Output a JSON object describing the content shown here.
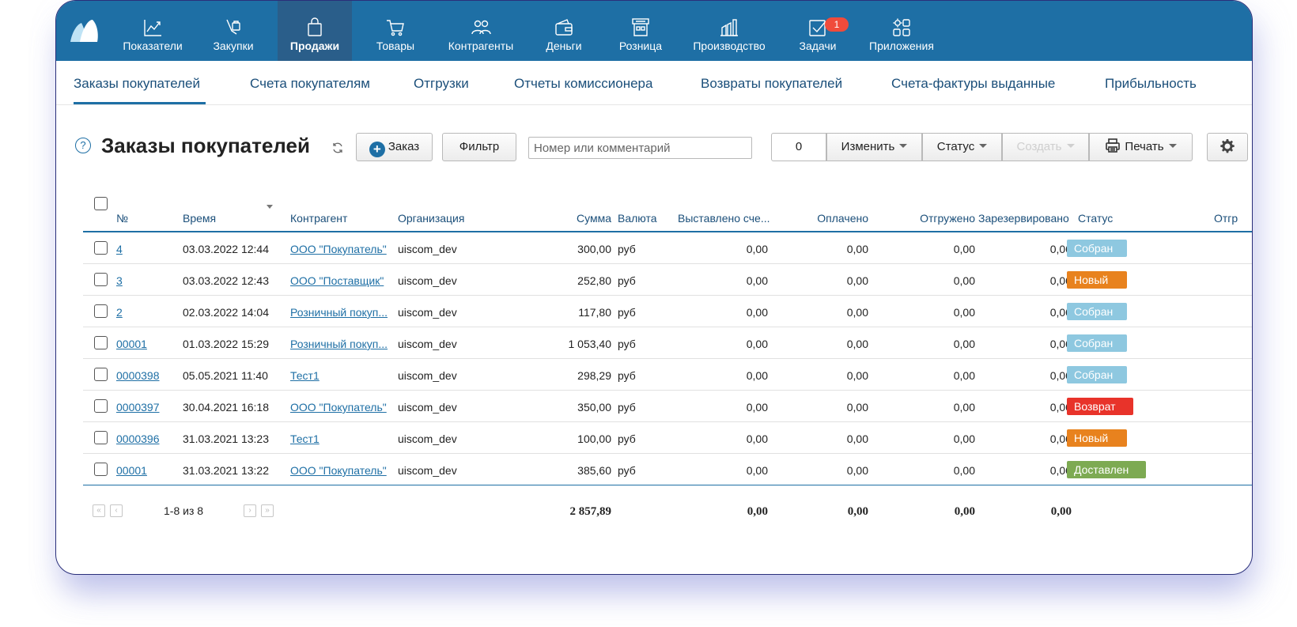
{
  "colors": {
    "nav_bg": "#1e6fa5",
    "nav_active": "#2a5e8a",
    "badge": "#f04b3b",
    "link": "#1e6fa5"
  },
  "nav": {
    "items": [
      {
        "label": "Показатели",
        "icon": "chart-line-icon"
      },
      {
        "label": "Закупки",
        "icon": "hand-bag-icon"
      },
      {
        "label": "Продажи",
        "icon": "shopping-bag-icon",
        "active": true
      },
      {
        "label": "Товары",
        "icon": "cart-icon"
      },
      {
        "label": "Контрагенты",
        "icon": "users-icon"
      },
      {
        "label": "Деньги",
        "icon": "wallet-icon"
      },
      {
        "label": "Розница",
        "icon": "store-icon"
      },
      {
        "label": "Производство",
        "icon": "factory-icon"
      },
      {
        "label": "Задачи",
        "icon": "checkbox-icon",
        "badge": "1"
      },
      {
        "label": "Приложения",
        "icon": "apps-grid-icon"
      }
    ]
  },
  "subtabs": [
    "Заказы покупателей",
    "Счета покупателям",
    "Отгрузки",
    "Отчеты комиссионера",
    "Возвраты покупателей",
    "Счета-фактуры выданные",
    "Прибыльность"
  ],
  "toolbar": {
    "help": "?",
    "title": "Заказы покупателей",
    "order_btn": "Заказ",
    "filter_btn": "Фильтр",
    "search_placeholder": "Номер или комментарий",
    "selected_count": "0",
    "change_btn": "Изменить",
    "status_btn": "Статус",
    "create_btn": "Создать",
    "print_btn": "Печать"
  },
  "table": {
    "headers": [
      "№",
      "Время",
      "Контрагент",
      "Организация",
      "Сумма",
      "Валюта",
      "Выставлено сче...",
      "Оплачено",
      "Отгружено",
      "Зарезервировано",
      "Статус",
      "Отгр"
    ],
    "rows": [
      {
        "num": "4",
        "time": "03.03.2022 12:44",
        "contractor": "ООО \"Покупатель\"",
        "org": "uiscom_dev",
        "sum": "300,00",
        "currency": "руб",
        "invoiced": "0,00",
        "paid": "0,00",
        "shipped": "0,00",
        "reserved": "0,00",
        "status": "Собран",
        "status_color": "#8ec8e0"
      },
      {
        "num": "3",
        "time": "03.03.2022 12:43",
        "contractor": "ООО \"Поставщик\"",
        "org": "uiscom_dev",
        "sum": "252,80",
        "currency": "руб",
        "invoiced": "0,00",
        "paid": "0,00",
        "shipped": "0,00",
        "reserved": "0,00",
        "status": "Новый",
        "status_color": "#e8821e"
      },
      {
        "num": "2",
        "time": "02.03.2022 14:04",
        "contractor": "Розничный покуп...",
        "org": "uiscom_dev",
        "sum": "117,80",
        "currency": "руб",
        "invoiced": "0,00",
        "paid": "0,00",
        "shipped": "0,00",
        "reserved": "0,00",
        "status": "Собран",
        "status_color": "#8ec8e0"
      },
      {
        "num": "00001",
        "time": "01.03.2022 15:29",
        "contractor": "Розничный покуп...",
        "org": "uiscom_dev",
        "sum": "1 053,40",
        "currency": "руб",
        "invoiced": "0,00",
        "paid": "0,00",
        "shipped": "0,00",
        "reserved": "0,00",
        "status": "Собран",
        "status_color": "#8ec8e0"
      },
      {
        "num": "0000398",
        "time": "05.05.2021 11:40",
        "contractor": "Тест1",
        "org": "uiscom_dev",
        "sum": "298,29",
        "currency": "руб",
        "invoiced": "0,00",
        "paid": "0,00",
        "shipped": "0,00",
        "reserved": "0,00",
        "status": "Собран",
        "status_color": "#8ec8e0"
      },
      {
        "num": "0000397",
        "time": "30.04.2021 16:18",
        "contractor": "ООО \"Покупатель\"",
        "org": "uiscom_dev",
        "sum": "350,00",
        "currency": "руб",
        "invoiced": "0,00",
        "paid": "0,00",
        "shipped": "0,00",
        "reserved": "0,00",
        "status": "Возврат",
        "status_color": "#e8332a"
      },
      {
        "num": "0000396",
        "time": "31.03.2021 13:23",
        "contractor": "Тест1",
        "org": "uiscom_dev",
        "sum": "100,00",
        "currency": "руб",
        "invoiced": "0,00",
        "paid": "0,00",
        "shipped": "0,00",
        "reserved": "0,00",
        "status": "Новый",
        "status_color": "#e8821e"
      },
      {
        "num": "00001",
        "time": "31.03.2021 13:22",
        "contractor": "ООО \"Покупатель\"",
        "org": "uiscom_dev",
        "sum": "385,60",
        "currency": "руб",
        "invoiced": "0,00",
        "paid": "0,00",
        "shipped": "0,00",
        "reserved": "0,00",
        "status": "Доставлен",
        "status_color": "#7daa52"
      }
    ],
    "footer": {
      "range": "1-8 из 8",
      "pager": [
        "«",
        "‹",
        "›",
        "»"
      ],
      "totals": {
        "sum": "2 857,89",
        "invoiced": "0,00",
        "paid": "0,00",
        "shipped": "0,00",
        "reserved": "0,00"
      }
    }
  }
}
